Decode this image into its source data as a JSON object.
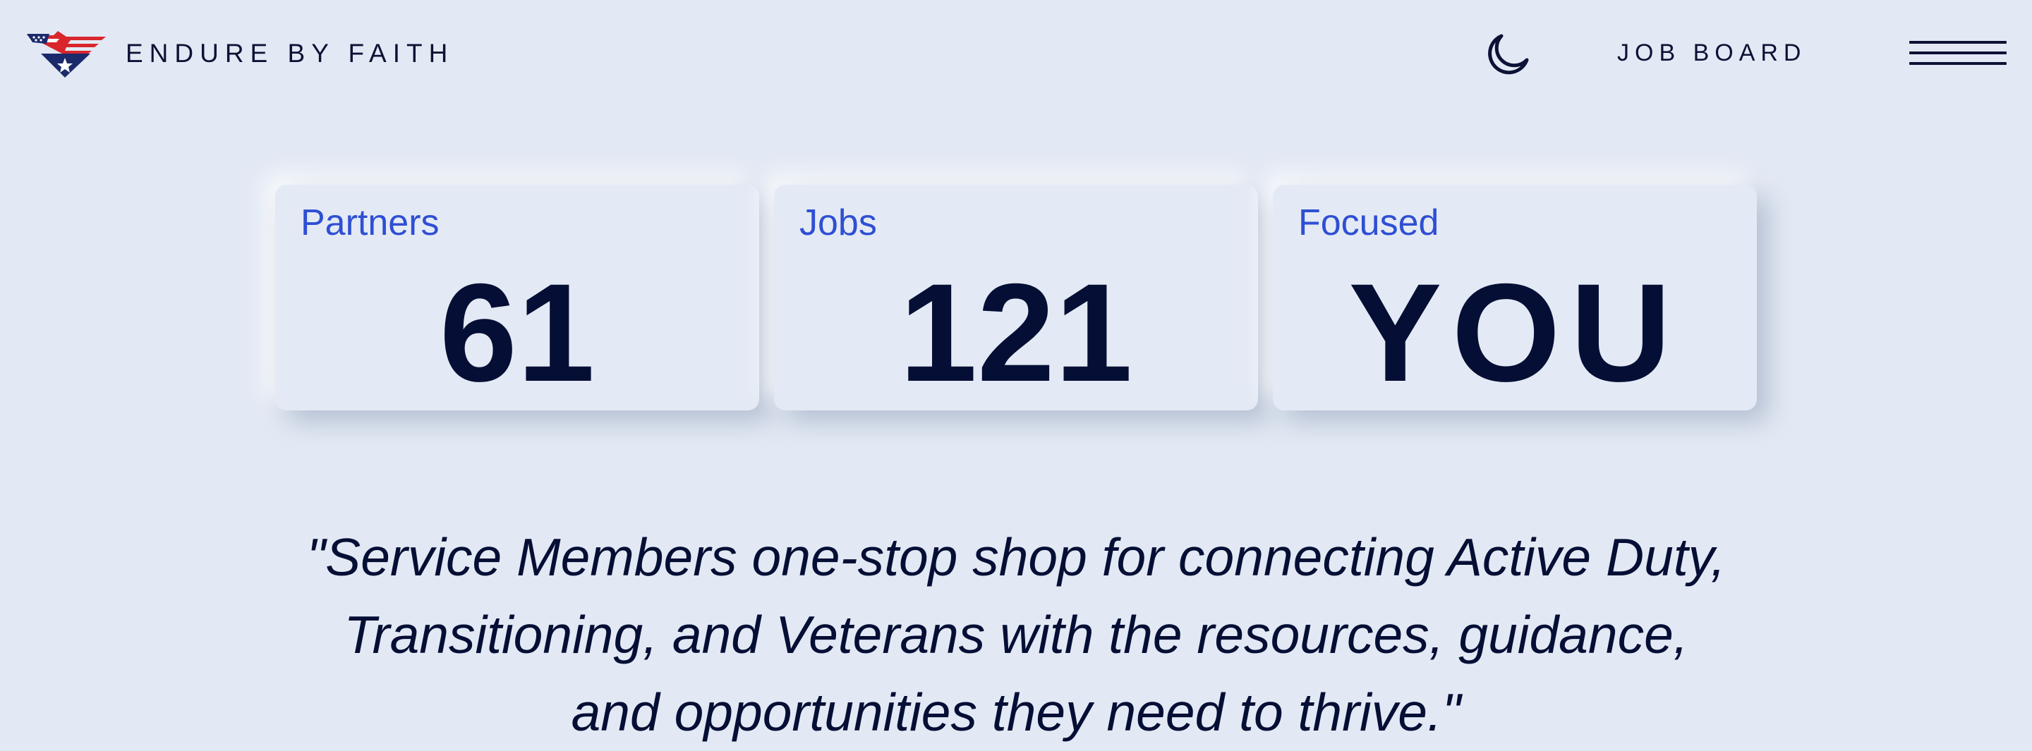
{
  "header": {
    "brand_name": "ENDURE BY FAITH",
    "logo_icon": "eagle-flag-logo-icon",
    "theme_toggle_icon": "moon-icon",
    "job_board_label": "JOB BOARD",
    "menu_icon": "hamburger-menu-icon"
  },
  "stats": [
    {
      "label": "Partners",
      "value": "61"
    },
    {
      "label": "Jobs",
      "value": "121"
    },
    {
      "label": "Focused",
      "value": "YOU"
    }
  ],
  "mission": {
    "line_1": "\"Service Members one-stop shop for connecting Active Duty,",
    "line_2": "Transitioning, and Veterans with the resources, guidance,",
    "line_3": "and opportunities they need to thrive.\""
  },
  "colors": {
    "background": "#e3e9f4",
    "card_background": "#e4eaf5",
    "label_blue": "#2f4fd3",
    "text_navy": "#050f35",
    "logo_red": "#d8262c",
    "logo_navy": "#1b2a6b"
  }
}
